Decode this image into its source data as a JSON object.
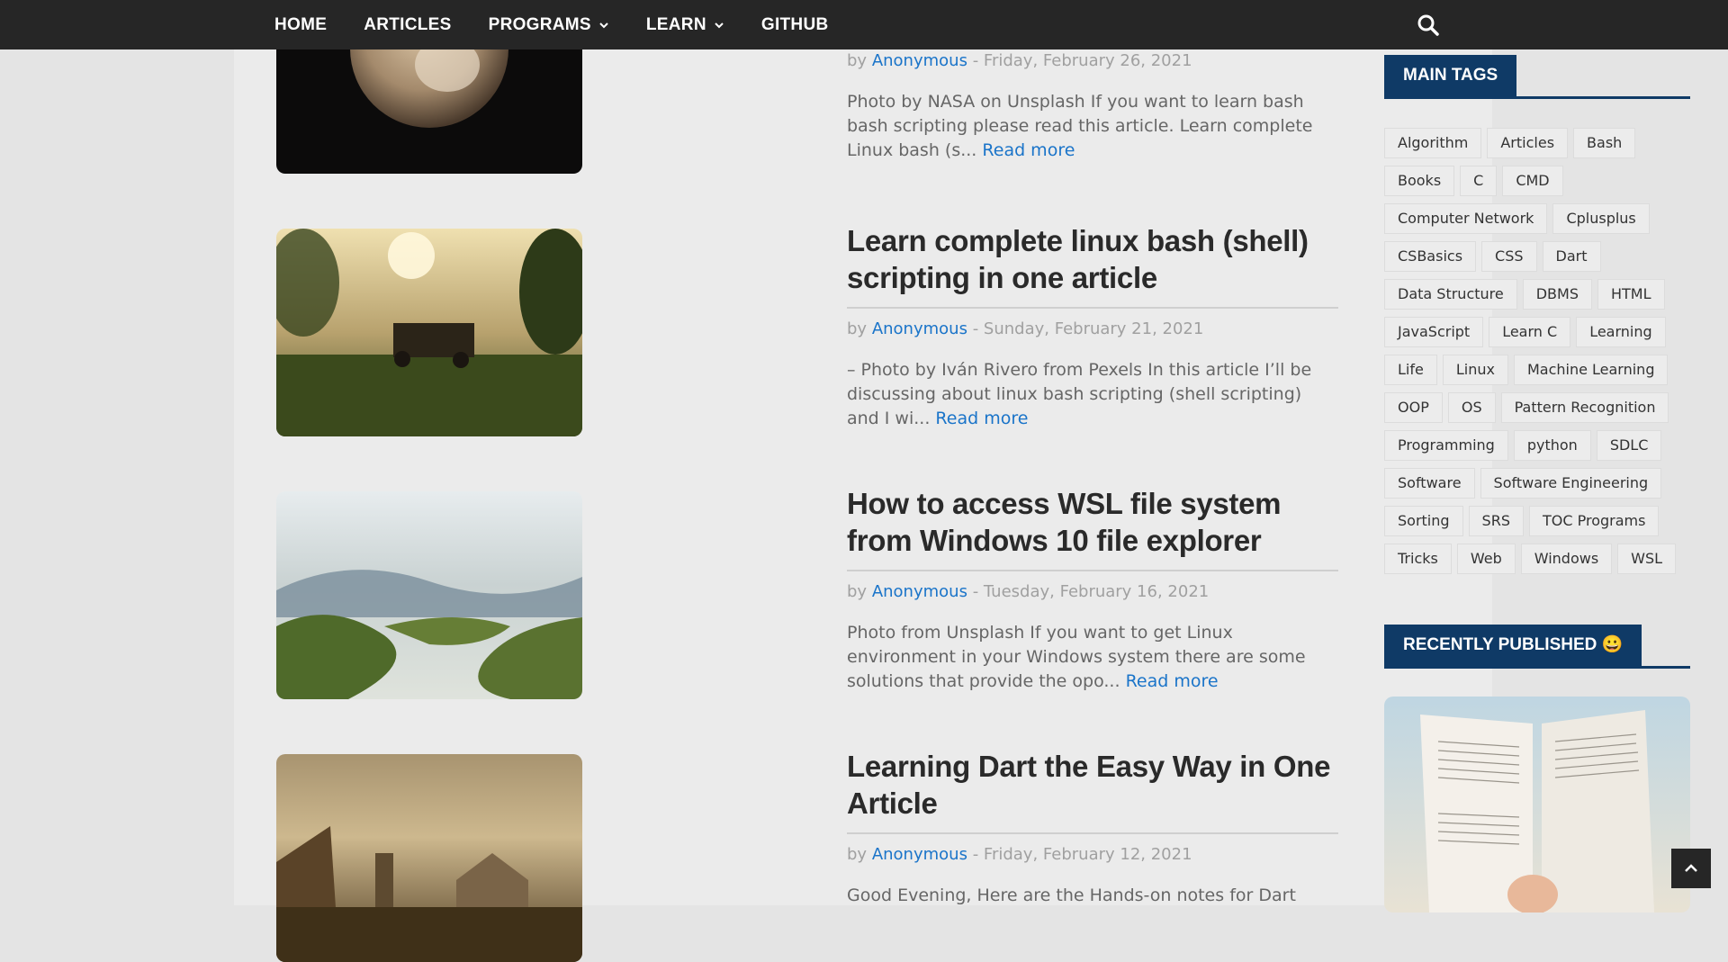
{
  "nav": {
    "items": [
      {
        "label": "HOME",
        "dropdown": false
      },
      {
        "label": "ARTICLES",
        "dropdown": false
      },
      {
        "label": "PROGRAMS",
        "dropdown": true
      },
      {
        "label": "LEARN",
        "dropdown": true
      },
      {
        "label": "GITHUB",
        "dropdown": false
      }
    ],
    "search_icon": "search-icon"
  },
  "posts": [
    {
      "title": "",
      "author_prefix": "by",
      "author": "Anonymous",
      "date": "- Friday, February 26, 2021",
      "excerpt": "Photo by NASA on Unsplash If you want to learn bash bash scripting please read this article. Learn complete Linux bash (s...",
      "read_more": "Read more"
    },
    {
      "title": "Learn complete linux bash (shell) scripting in one article",
      "author_prefix": "by",
      "author": "Anonymous",
      "date": "- Sunday, February 21, 2021",
      "excerpt": "– Photo by Iván Rivero from Pexels In this article I’ll be discussing about linux bash scripting (shell scripting) and I wi...",
      "read_more": "Read more"
    },
    {
      "title": "How to access WSL file system from Windows 10 file explorer",
      "author_prefix": "by",
      "author": "Anonymous",
      "date": "- Tuesday, February 16, 2021",
      "excerpt": "Photo from Unsplash If you want to get Linux environment in your Windows system there are some solutions that provide the opo...",
      "read_more": "Read more"
    },
    {
      "title": "Learning Dart the Easy Way in One Article",
      "author_prefix": "by",
      "author": "Anonymous",
      "date": "- Friday, February 12, 2021",
      "excerpt": "Good Evening, Here are the Hands-on notes for Dart",
      "read_more": ""
    }
  ],
  "sidebar": {
    "tags_title": "MAIN TAGS",
    "tags": [
      "Algorithm",
      "Articles",
      "Bash",
      "Books",
      "C",
      "CMD",
      "Computer Network",
      "Cplusplus",
      "CSBasics",
      "CSS",
      "Dart",
      "Data Structure",
      "DBMS",
      "HTML",
      "JavaScript",
      "Learn C",
      "Learning",
      "Life",
      "Linux",
      "Machine Learning",
      "OOP",
      "OS",
      "Pattern Recognition",
      "Programming",
      "python",
      "SDLC",
      "Software",
      "Software Engineering",
      "Sorting",
      "SRS",
      "TOC Programs",
      "Tricks",
      "Web",
      "Windows",
      "WSL"
    ],
    "recent_title": "RECENTLY PUBLISHED 😀"
  },
  "colors": {
    "navbar": "#262626",
    "accent": "#0f3a66",
    "link": "#1a74c9"
  },
  "back_to_top_icon": "chevron-up-icon"
}
